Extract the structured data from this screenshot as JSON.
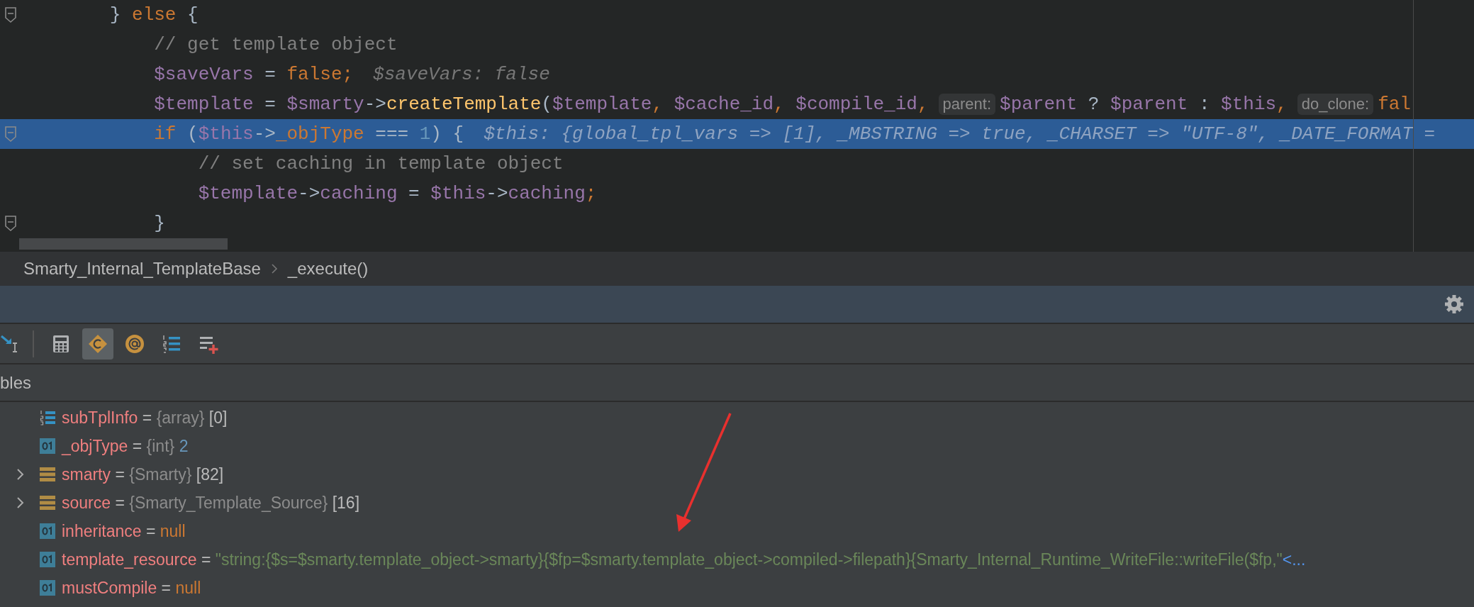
{
  "editor": {
    "lines": [
      {
        "fold_marker": true,
        "current": false,
        "segments": [
          {
            "kind": "code",
            "tokens": [
              {
                "kind": "plain",
                "text": "        } "
              },
              {
                "kind": "kw",
                "text": "else"
              },
              {
                "kind": "plain",
                "text": " {"
              }
            ]
          }
        ]
      },
      {
        "fold_marker": false,
        "current": false,
        "segments": [
          {
            "kind": "code",
            "tokens": [
              {
                "kind": "cm",
                "text": "            // get template object"
              }
            ]
          }
        ]
      },
      {
        "fold_marker": false,
        "current": false,
        "segments": [
          {
            "kind": "code",
            "tokens": [
              {
                "kind": "var",
                "text": "            $saveVars"
              },
              {
                "kind": "plain",
                "text": " = "
              },
              {
                "kind": "kw",
                "text": "false"
              },
              {
                "kind": "punct",
                "text": ";"
              }
            ]
          },
          {
            "kind": "inline_value",
            "text": "$saveVars: false"
          }
        ]
      },
      {
        "fold_marker": false,
        "current": false,
        "segments": [
          {
            "kind": "code",
            "tokens": [
              {
                "kind": "var",
                "text": "            $template"
              },
              {
                "kind": "plain",
                "text": " = "
              },
              {
                "kind": "var",
                "text": "$smarty"
              },
              {
                "kind": "plain",
                "text": "->"
              },
              {
                "kind": "fn",
                "text": "createTemplate"
              },
              {
                "kind": "plain",
                "text": "("
              },
              {
                "kind": "var",
                "text": "$template"
              },
              {
                "kind": "punct",
                "text": ", "
              },
              {
                "kind": "var",
                "text": "$cache_id"
              },
              {
                "kind": "punct",
                "text": ", "
              },
              {
                "kind": "var",
                "text": "$compile_id"
              },
              {
                "kind": "punct",
                "text": ","
              }
            ]
          },
          {
            "kind": "param_hint",
            "text": "parent:"
          },
          {
            "kind": "code",
            "tokens": [
              {
                "kind": "var",
                "text": "$parent"
              },
              {
                "kind": "plain",
                "text": " ? "
              },
              {
                "kind": "var",
                "text": "$parent"
              },
              {
                "kind": "plain",
                "text": " : "
              },
              {
                "kind": "var",
                "text": "$this"
              },
              {
                "kind": "punct",
                "text": ","
              }
            ]
          },
          {
            "kind": "param_hint",
            "text": "do_clone:"
          },
          {
            "kind": "code",
            "tokens": [
              {
                "kind": "kw",
                "text": "fal"
              }
            ]
          }
        ]
      },
      {
        "fold_marker": true,
        "current": true,
        "segments": [
          {
            "kind": "code",
            "tokens": [
              {
                "kind": "kw",
                "text": "            if"
              },
              {
                "kind": "plain",
                "text": " ("
              },
              {
                "kind": "var",
                "text": "$this"
              },
              {
                "kind": "plain",
                "text": "->"
              },
              {
                "kind": "field",
                "text": "_objType"
              },
              {
                "kind": "plain",
                "text": " === "
              },
              {
                "kind": "num",
                "text": "1"
              },
              {
                "kind": "plain",
                "text": ") {"
              }
            ]
          },
          {
            "kind": "inline_value",
            "text": "$this: {global_tpl_vars => [1], _MBSTRING => true, _CHARSET => \"UTF-8\", _DATE_FORMAT ="
          }
        ]
      },
      {
        "fold_marker": false,
        "current": false,
        "segments": [
          {
            "kind": "code",
            "tokens": [
              {
                "kind": "cm",
                "text": "                // set caching in template object"
              }
            ]
          }
        ]
      },
      {
        "fold_marker": false,
        "current": false,
        "segments": [
          {
            "kind": "code",
            "tokens": [
              {
                "kind": "var",
                "text": "                $template"
              },
              {
                "kind": "plain",
                "text": "->"
              },
              {
                "kind": "var",
                "text": "caching"
              },
              {
                "kind": "plain",
                "text": " = "
              },
              {
                "kind": "var",
                "text": "$this"
              },
              {
                "kind": "plain",
                "text": "->"
              },
              {
                "kind": "var",
                "text": "caching"
              },
              {
                "kind": "punct",
                "text": ";"
              }
            ]
          }
        ]
      },
      {
        "fold_marker": true,
        "current": false,
        "segments": [
          {
            "kind": "code",
            "tokens": [
              {
                "kind": "plain",
                "text": "            }"
              }
            ]
          }
        ]
      }
    ]
  },
  "breadcrumb": [
    "Smarty_Internal_TemplateBase",
    "_execute()"
  ],
  "toolbar": [
    {
      "kind": "step",
      "selected": false
    },
    {
      "kind": "calculator",
      "selected": false
    },
    {
      "kind": "class",
      "selected": true
    },
    {
      "kind": "at",
      "selected": false
    },
    {
      "kind": "numbered",
      "selected": false
    },
    {
      "kind": "add_list",
      "selected": false
    }
  ],
  "panel_label": "bles",
  "variables": [
    {
      "kind": "array",
      "expandable": false,
      "name": "subTplInfo",
      "operator": "=",
      "type": "{array}",
      "value": {
        "kind": "count",
        "text": "[0]"
      }
    },
    {
      "kind": "field",
      "expandable": false,
      "name": "_objType",
      "operator": "=",
      "type": "{int}",
      "value": {
        "kind": "number",
        "text": "2"
      }
    },
    {
      "kind": "object",
      "expandable": true,
      "name": "smarty",
      "operator": "=",
      "type": "{Smarty}",
      "value": {
        "kind": "count",
        "text": "[82]"
      }
    },
    {
      "kind": "object",
      "expandable": true,
      "name": "source",
      "operator": "=",
      "type": "{Smarty_Template_Source}",
      "value": {
        "kind": "count",
        "text": "[16]"
      }
    },
    {
      "kind": "field",
      "expandable": false,
      "name": "inheritance",
      "operator": "=",
      "value": {
        "kind": "keyword",
        "text": "null"
      }
    },
    {
      "kind": "field",
      "expandable": false,
      "name": "template_resource",
      "operator": "=",
      "value": {
        "kind": "string",
        "text": "\"string:{$s=$smarty.template_object->smarty}{$fp=$smarty.template_object->compiled->filepath}{Smarty_Internal_Runtime_WriteFile::writeFile($fp,\""
      },
      "more": "<..."
    },
    {
      "kind": "field",
      "expandable": false,
      "name": "mustCompile",
      "operator": "=",
      "value": {
        "kind": "keyword",
        "text": "null"
      }
    }
  ]
}
